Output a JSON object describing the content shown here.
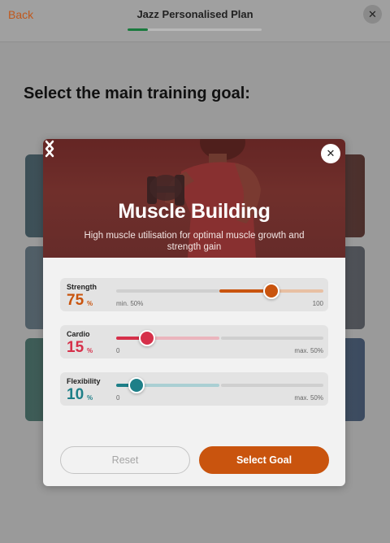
{
  "header": {
    "back_label": "Back",
    "title": "Jazz Personalised Plan",
    "progress": 0.15,
    "close_icon": "close-icon"
  },
  "page": {
    "heading": "Select the main training goal:"
  },
  "modal": {
    "title": "Muscle Building",
    "description": "High muscle utilisation for optimal muscle growth and strength gain",
    "close_icon": "close-icon",
    "prev_icon": "chevron-left-icon",
    "next_icon": "chevron-right-icon",
    "metrics": [
      {
        "label": "Strength",
        "value": "75",
        "unit": "%",
        "min_label": "min. 50%",
        "max_label": "100",
        "level_percent": 75,
        "color": "#c9540e",
        "range_color": "#e8c0a3"
      },
      {
        "label": "Cardio",
        "value": "15",
        "unit": "%",
        "min_label": "0",
        "max_label": "max. 50%",
        "level_percent": 15,
        "color": "#d6304a",
        "range_color": "#ebb5bd"
      },
      {
        "label": "Flexibility",
        "value": "10",
        "unit": "%",
        "min_label": "0",
        "max_label": "max. 50%",
        "level_percent": 10,
        "color": "#1e7f88",
        "range_color": "#aacfd3"
      }
    ],
    "reset_label": "Reset",
    "select_label": "Select Goal"
  },
  "colors": {
    "accent": "#c9540e",
    "progress_green": "#1a7a3e"
  }
}
